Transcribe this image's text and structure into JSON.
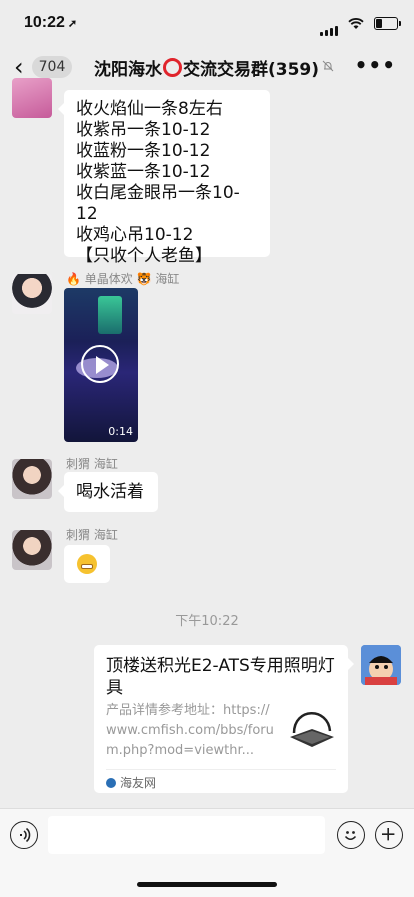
{
  "status": {
    "time": "10:22",
    "location_icon": "location-arrow-icon"
  },
  "nav": {
    "back_badge": "704",
    "title_prefix": "沈阳海水",
    "title_suffix": "交流交易群",
    "member_count": "(359)"
  },
  "messages": [
    {
      "type": "text",
      "lines": [
        "收火焰仙一条8左右",
        "收紫吊一条10-12",
        "收蓝粉一条10-12",
        "收紫蓝一条10-12",
        "收白尾金眼吊一条10-12",
        "收鸡心吊10-12",
        "【只收个人老鱼】"
      ]
    },
    {
      "type": "video",
      "sender": "单晶体欢",
      "sender_suffix": "海缸",
      "duration": "0:14"
    },
    {
      "type": "text",
      "sender": "刺猬 海缸",
      "text": "喝水活着"
    },
    {
      "type": "emoji",
      "sender": "刺猬 海缸",
      "emoji": "grimacing"
    }
  ],
  "timestamp": "下午10:22",
  "link_card": {
    "title": "顶楼送积光E2-ATS专用照明灯具",
    "description": "产品详情参考地址：https://www.cmfish.com/bbs/forum.php?mod=viewthr...",
    "source": "海友网"
  },
  "input": {
    "placeholder": ""
  }
}
